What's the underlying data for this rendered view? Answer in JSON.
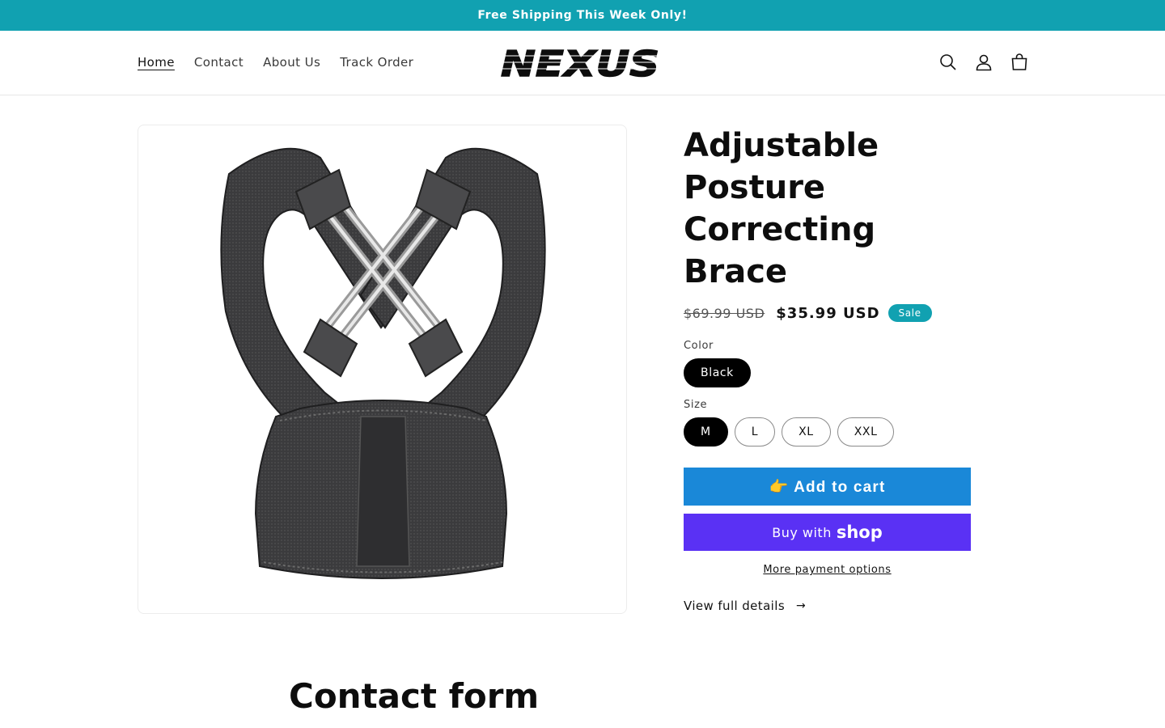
{
  "announcement": {
    "text": "Free Shipping This Week Only!"
  },
  "header": {
    "nav": [
      {
        "label": "Home",
        "active": true
      },
      {
        "label": "Contact"
      },
      {
        "label": "About Us"
      },
      {
        "label": "Track Order"
      }
    ],
    "logo_text": "NEXUS",
    "icons": [
      "search-icon",
      "account-icon",
      "cart-icon"
    ]
  },
  "product": {
    "title": "Adjustable Posture Correcting Brace",
    "price_original": "$69.99 USD",
    "price_sale": "$35.99 USD",
    "badge": "Sale",
    "color_label": "Color",
    "colors": [
      "Black"
    ],
    "color_selected": "Black",
    "size_label": "Size",
    "sizes": [
      "M",
      "L",
      "XL",
      "XXL"
    ],
    "size_selected": "M",
    "add_to_cart": "👉 Add to cart",
    "buy_with": "Buy with",
    "buy_brand": "shop",
    "more_payment": "More payment options",
    "view_details": "View full details",
    "view_details_arrow": "→"
  },
  "contact": {
    "title": "Contact form"
  },
  "colors": {
    "accent": "#11a1b1",
    "add_to_cart": "#1a88d8",
    "shop_pay": "#5a31f4"
  }
}
